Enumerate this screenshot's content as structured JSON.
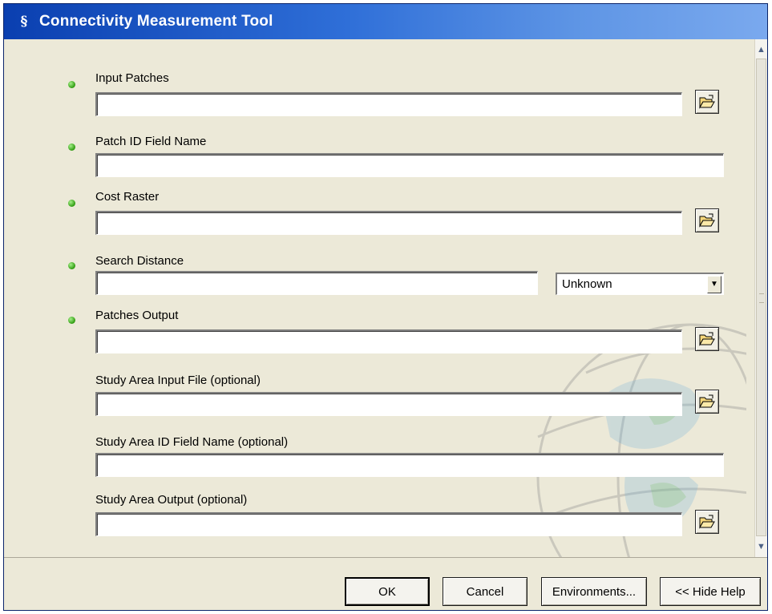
{
  "window": {
    "title": "Connectivity Measurement Tool",
    "icon": "script-icon"
  },
  "fields": {
    "input_patches": {
      "label": "Input Patches",
      "value": "",
      "required": true
    },
    "patch_id_field": {
      "label": "Patch ID Field Name",
      "value": "",
      "required": true
    },
    "cost_raster": {
      "label": "Cost Raster",
      "value": "",
      "required": true
    },
    "search_distance": {
      "label": "Search Distance",
      "value": "",
      "unit": "Unknown",
      "required": true
    },
    "patches_output": {
      "label": "Patches Output",
      "value": "",
      "required": true
    },
    "study_area_input": {
      "label": "Study Area Input File (optional)",
      "value": "",
      "required": false
    },
    "study_area_id_field": {
      "label": "Study Area ID Field Name (optional)",
      "value": "",
      "required": false
    },
    "study_area_output": {
      "label": "Study Area Output (optional)",
      "value": "",
      "required": false
    }
  },
  "buttons": {
    "ok": "OK",
    "cancel": "Cancel",
    "environments": "Environments...",
    "hide_help": "<< Hide Help"
  },
  "icons": {
    "browse": "open-folder-icon",
    "required": "green-bullet-icon",
    "background": "globe-watermark"
  },
  "colors": {
    "titlebar_start": "#0a3fb0",
    "titlebar_end": "#7aa9ee",
    "panel": "#ece9d8",
    "required_dot": "#2e9b0f"
  }
}
